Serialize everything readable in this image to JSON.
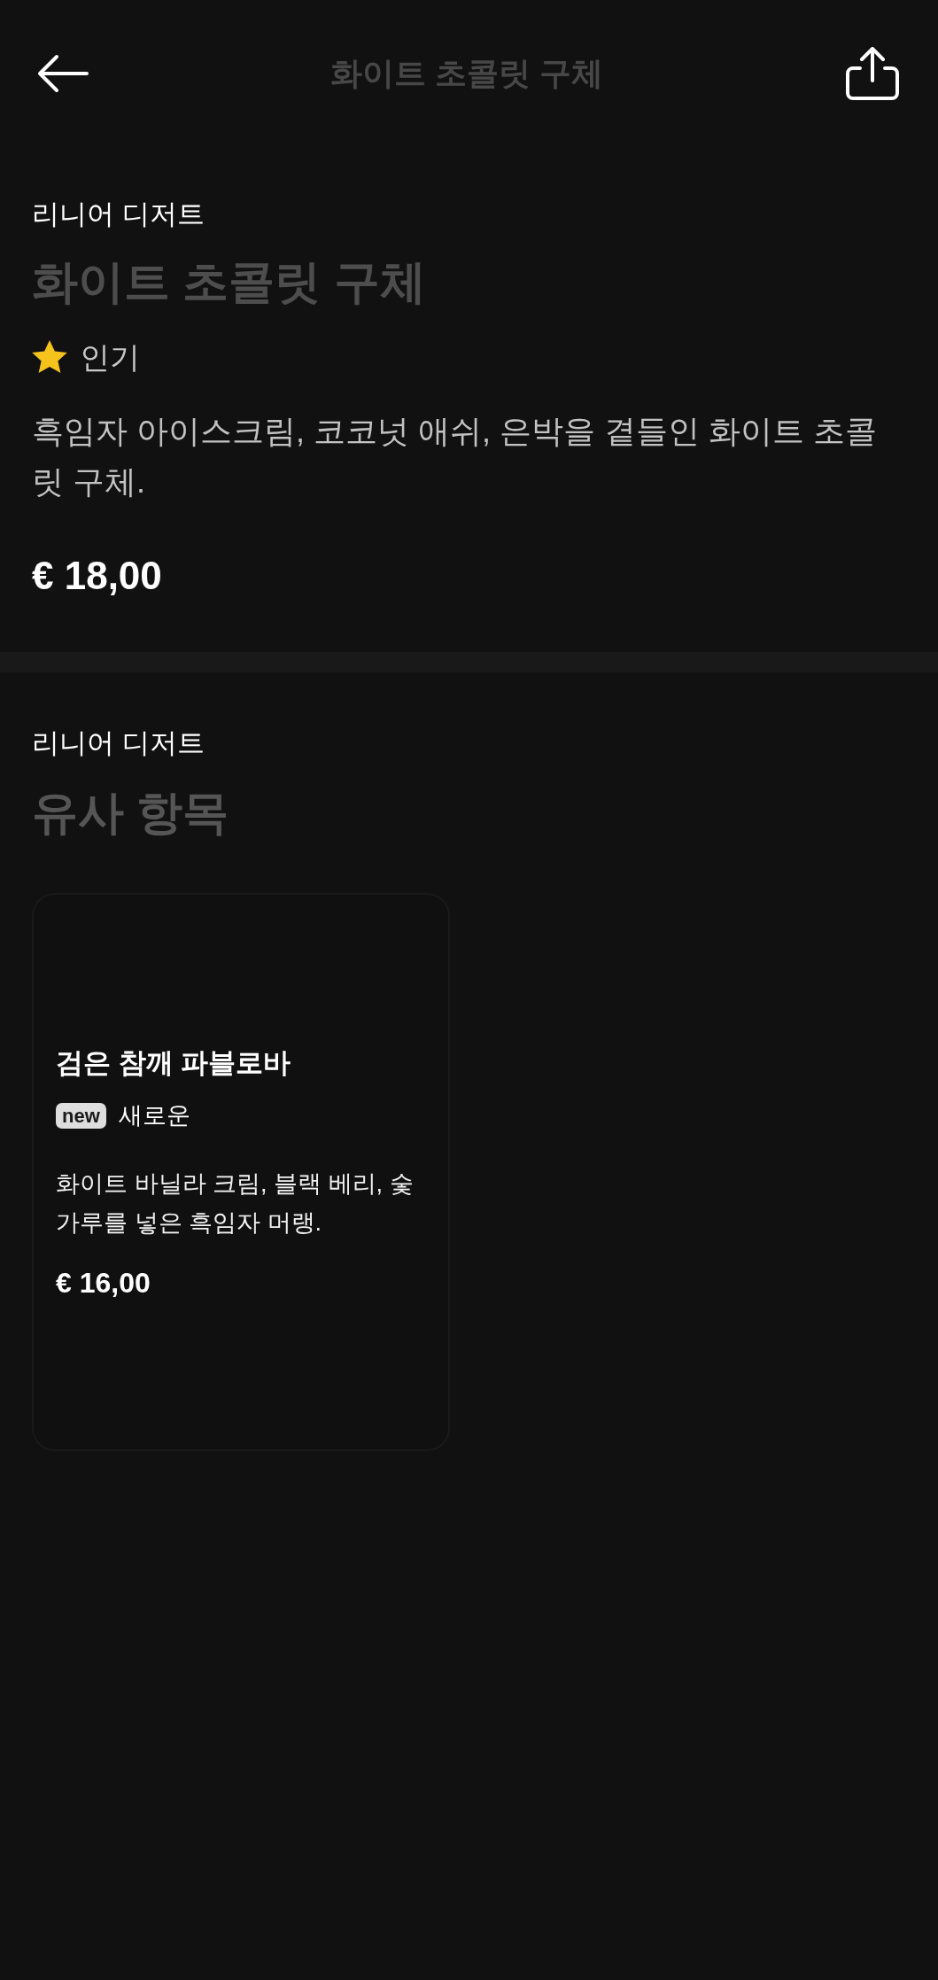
{
  "header": {
    "title": "화이트 초콜릿 구체"
  },
  "product": {
    "category": "리니어 디저트",
    "name": "화이트 초콜릿 구체",
    "badge": {
      "kind": "popular",
      "label": "인기"
    },
    "description": "흑임자 아이스크림, 코코넛 애쉬, 은박을 곁들인 화이트 초콜릿 구체.",
    "price": "€ 18,00"
  },
  "similar": {
    "category": "리니어 디저트",
    "title": "유사 항목",
    "items": [
      {
        "name": "검은 참깨 파블로바",
        "badge": {
          "kind": "new",
          "tag": "new",
          "label": "새로운"
        },
        "description": "화이트 바닐라 크림, 블랙 베리, 숯 가루를 넣은 흑임자 머랭.",
        "price": "€ 16,00"
      }
    ]
  }
}
